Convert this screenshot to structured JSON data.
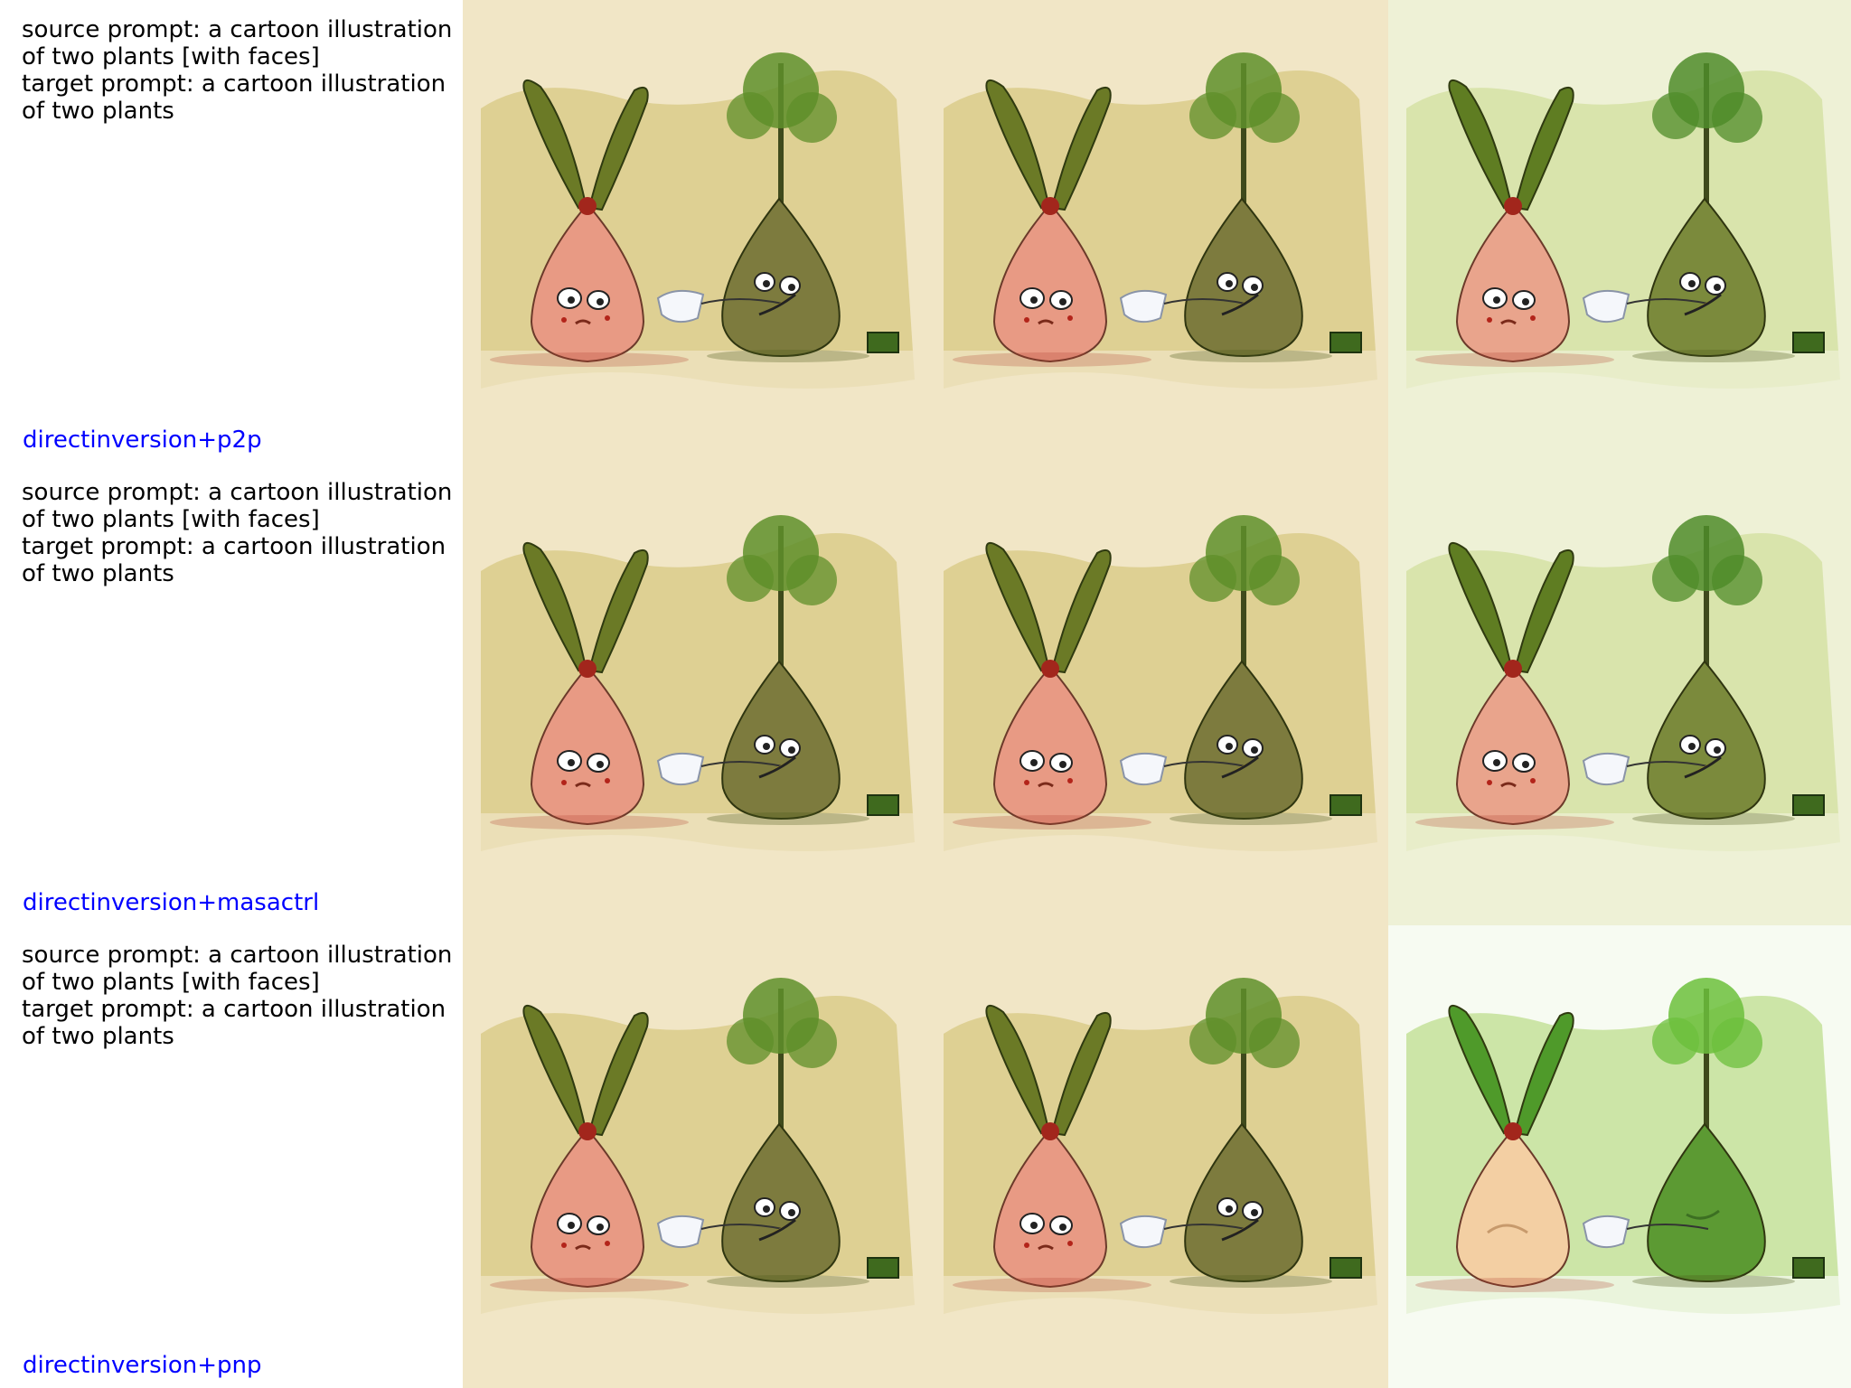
{
  "rows": [
    {
      "source_prompt": "source prompt: a cartoon illustration of two plants [with faces]",
      "target_prompt": "target prompt: a cartoon illustration of two plants",
      "method": "directinversion+p2p"
    },
    {
      "source_prompt": "source prompt: a cartoon illustration of two plants [with faces]",
      "target_prompt": "target prompt: a cartoon illustration of two plants",
      "method": "directinversion+masactrl"
    },
    {
      "source_prompt": "source prompt: a cartoon illustration of two plants [with faces]",
      "target_prompt": "target prompt: a cartoon illustration of two plants",
      "method": "directinversion+pnp"
    }
  ],
  "panel_styles": {
    "original": {
      "bg": "#f1e6c6",
      "wash": "#cdbd6a",
      "onion": "#e89a84",
      "pot": "#7d7b3e",
      "leaf": "#6b7a26",
      "tree": "#5f8f2a",
      "faces": true
    },
    "edited_green": {
      "bg": "#eef1d6",
      "wash": "#c8d88a",
      "onion": "#e9a48c",
      "pot": "#7b8a3c",
      "leaf": "#5f7d22",
      "tree": "#4f8c2a",
      "faces": true
    },
    "edited_fresh": {
      "bg": "#f7fbf2",
      "wash": "#a9d36a",
      "onion": "#f3cfa3",
      "pot": "#5c9a33",
      "leaf": "#4f9a2a",
      "tree": "#6cbf3c",
      "faces": false
    }
  }
}
